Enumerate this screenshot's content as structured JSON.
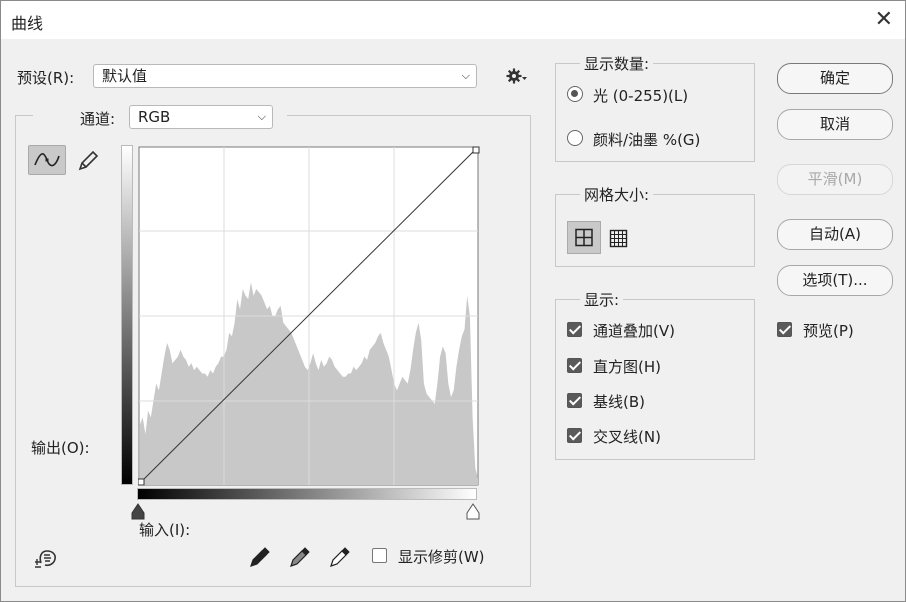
{
  "window": {
    "title": "曲线",
    "close_glyph": "✕"
  },
  "preset": {
    "label": "预设(R):",
    "value": "默认值"
  },
  "channel": {
    "label": "通道:",
    "value": "RGB"
  },
  "axis": {
    "output_label": "输出(O):",
    "input_label": "输入(I):"
  },
  "clipping": {
    "label": "显示修剪(W)",
    "checked": false
  },
  "display_amount": {
    "title": "显示数量:",
    "options": [
      {
        "label": "光 (0-255)(L)",
        "selected": true
      },
      {
        "label": "颜料/油墨 %(G)",
        "selected": false
      }
    ]
  },
  "grid_size": {
    "title": "网格大小:",
    "selected": "simple"
  },
  "show": {
    "title": "显示:",
    "items": [
      {
        "label": "通道叠加(V)",
        "checked": true
      },
      {
        "label": "直方图(H)",
        "checked": true
      },
      {
        "label": "基线(B)",
        "checked": true
      },
      {
        "label": "交叉线(N)",
        "checked": true
      }
    ]
  },
  "buttons": {
    "ok": "确定",
    "cancel": "取消",
    "smooth": "平滑(M)",
    "auto": "自动(A)",
    "options": "选项(T)..."
  },
  "preview": {
    "label": "预览(P)",
    "checked": true
  },
  "icons": {
    "gear": "gear-icon",
    "curve_tool": "curve-point-icon",
    "pencil_tool": "pencil-icon",
    "black_eyedropper": "eyedropper-black-icon",
    "gray_eyedropper": "eyedropper-gray-icon",
    "white_eyedropper": "eyedropper-white-icon",
    "target_adjust": "hand-adjust-icon"
  },
  "histogram": {
    "levels": [
      0.18,
      0.2,
      0.15,
      0.22,
      0.2,
      0.25,
      0.3,
      0.28,
      0.33,
      0.38,
      0.42,
      0.4,
      0.36,
      0.37,
      0.38,
      0.4,
      0.38,
      0.37,
      0.35,
      0.36,
      0.34,
      0.35,
      0.34,
      0.33,
      0.33,
      0.32,
      0.34,
      0.33,
      0.35,
      0.36,
      0.38,
      0.38,
      0.4,
      0.45,
      0.44,
      0.48,
      0.55,
      0.52,
      0.58,
      0.56,
      0.55,
      0.6,
      0.56,
      0.58,
      0.57,
      0.56,
      0.54,
      0.52,
      0.53,
      0.5,
      0.5,
      0.52,
      0.53,
      0.48,
      0.47,
      0.46,
      0.45,
      0.43,
      0.41,
      0.39,
      0.37,
      0.35,
      0.34,
      0.36,
      0.39,
      0.36,
      0.34,
      0.37,
      0.35,
      0.36,
      0.38,
      0.37,
      0.35,
      0.34,
      0.33,
      0.32,
      0.32,
      0.33,
      0.33,
      0.35,
      0.34,
      0.35,
      0.36,
      0.38,
      0.37,
      0.4,
      0.41,
      0.42,
      0.44,
      0.45,
      0.42,
      0.4,
      0.38,
      0.34,
      0.3,
      0.28,
      0.3,
      0.32,
      0.31,
      0.3,
      0.34,
      0.4,
      0.45,
      0.48,
      0.43,
      0.3,
      0.27,
      0.26,
      0.25,
      0.24,
      0.3,
      0.38,
      0.41,
      0.39,
      0.3,
      0.26,
      0.28,
      0.35,
      0.4,
      0.44,
      0.46,
      0.56,
      0.5,
      0.2,
      0.05,
      0.02
    ]
  }
}
